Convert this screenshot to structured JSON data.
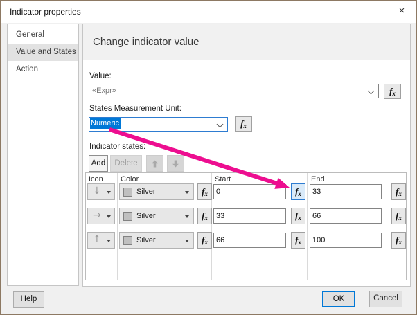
{
  "window": {
    "title": "Indicator properties",
    "close_icon": "×"
  },
  "sidebar": {
    "items": [
      {
        "label": "General",
        "selected": false
      },
      {
        "label": "Value and States",
        "selected": true
      },
      {
        "label": "Action",
        "selected": false
      }
    ]
  },
  "main": {
    "heading": "Change indicator value",
    "value_field": {
      "label": "Value:",
      "value": "«Expr»"
    },
    "unit_field": {
      "label": "States Measurement Unit:",
      "value": "Numeric",
      "focused": true
    },
    "states": {
      "label": "Indicator states:",
      "toolbar": {
        "add": "Add",
        "delete": "Delete",
        "move_up_icon": "up-arrow",
        "move_down_icon": "down-arrow"
      },
      "table": {
        "columns": [
          "Icon",
          "Color",
          "Start",
          "End"
        ],
        "rows": [
          {
            "icon": "down-arrow",
            "color": "Silver",
            "start": "0",
            "end": "33",
            "start_fx_highlighted": true
          },
          {
            "icon": "right-arrow",
            "color": "Silver",
            "start": "33",
            "end": "66",
            "start_fx_highlighted": false
          },
          {
            "icon": "up-arrow",
            "color": "Silver",
            "start": "66",
            "end": "100",
            "start_fx_highlighted": false
          }
        ]
      }
    }
  },
  "footer": {
    "help": "Help",
    "ok": "OK",
    "cancel": "Cancel"
  },
  "fx_glyph": {
    "f": "f",
    "x": "x"
  },
  "icons": {
    "down": "↓",
    "right": "→",
    "up": "↑"
  },
  "colors": {
    "accent": "#0078d7",
    "annotation": "#ed0e90",
    "silver": "#c0c0c0",
    "fx_highlight_bg": "#d9eaf9"
  }
}
